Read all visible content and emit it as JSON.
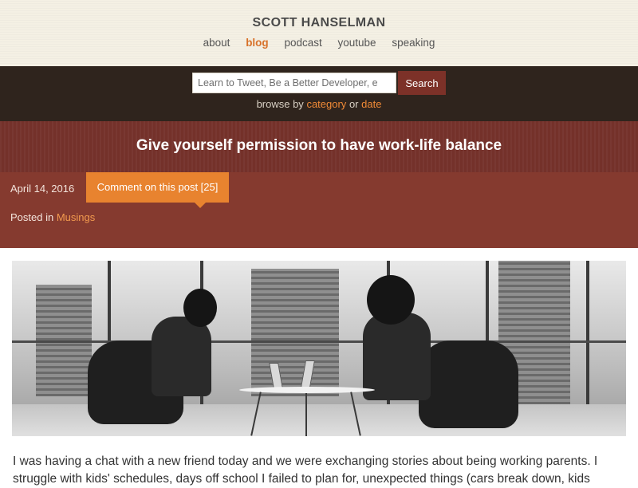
{
  "header": {
    "site_title": "SCOTT HANSELMAN",
    "nav": [
      {
        "label": "about",
        "active": false
      },
      {
        "label": "blog",
        "active": true
      },
      {
        "label": "podcast",
        "active": false
      },
      {
        "label": "youtube",
        "active": false
      },
      {
        "label": "speaking",
        "active": false
      }
    ]
  },
  "search": {
    "placeholder": "Learn to Tweet, Be a Better Developer, e",
    "button_label": "Search",
    "browse_prefix": "browse by",
    "browse_category": "category",
    "browse_or": "or",
    "browse_date": "date"
  },
  "post": {
    "title": "Give yourself permission to have work-life balance",
    "date": "April 14, 2016",
    "comment_link": "Comment on this post [25]",
    "posted_in_prefix": "Posted in",
    "category": "Musings",
    "body_line1": "I was having a chat with a new friend today and we were exchanging stories about being working parents. I",
    "body_line2": "struggle with kids' schedules, days off school I failed to plan for, unexpected things (cars break down, kids"
  },
  "colors": {
    "accent_orange": "#e8832f",
    "header_bg": "#f4f0e4",
    "search_band_bg": "#2f241d",
    "title_band_bg": "#74312a",
    "meta_band_bg": "#853a2f",
    "search_button_bg": "#7c3128"
  }
}
